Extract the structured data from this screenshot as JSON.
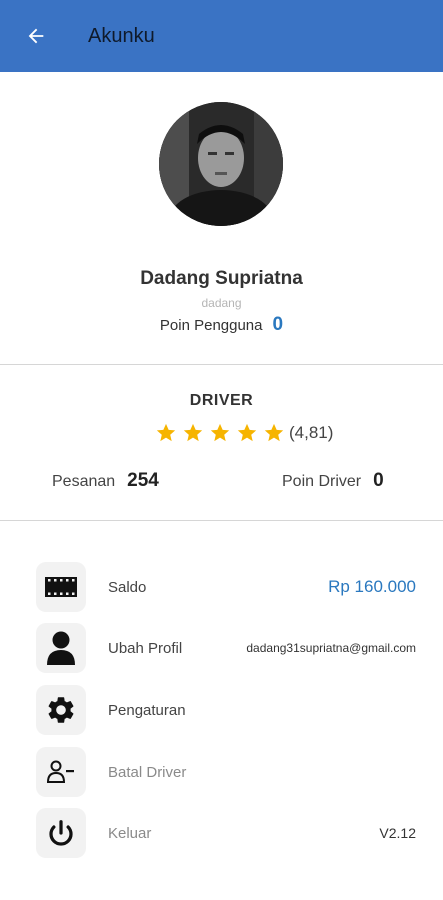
{
  "appbar": {
    "title": "Akunku"
  },
  "profile": {
    "name": "Dadang Supriatna",
    "username": "dadang",
    "points_label": "Poin Pengguna",
    "points_value": "0"
  },
  "driver": {
    "title": "DRIVER",
    "rating_text": "(4,81)",
    "stars": 5,
    "orders_label": "Pesanan",
    "orders_value": "254",
    "points_label": "Poin Driver",
    "points_value": "0"
  },
  "menu": [
    {
      "label": "Saldo",
      "value": "Rp 160.000",
      "icon": "wallet-icon"
    },
    {
      "label": "Ubah Profil",
      "value": "dadang31supriatna@gmail.com",
      "icon": "person-icon"
    },
    {
      "label": "Pengaturan",
      "value": "",
      "icon": "gear-icon"
    },
    {
      "label": "Batal Driver",
      "value": "",
      "icon": "remove-user-icon"
    },
    {
      "label": "Keluar",
      "value": "V2.12",
      "icon": "power-icon"
    }
  ],
  "colors": {
    "appbar": "#3a73c4",
    "accent_blue": "#2a78bf",
    "star": "#f6b400"
  }
}
